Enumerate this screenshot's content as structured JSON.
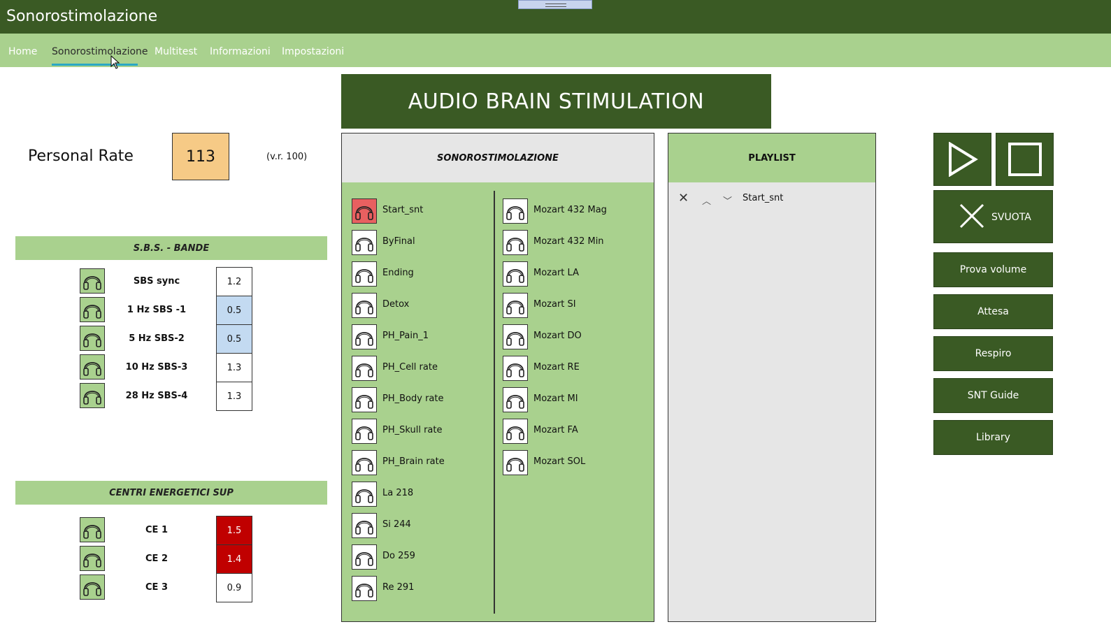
{
  "app": {
    "title": "Sonorostimolazione"
  },
  "nav": {
    "items": [
      {
        "label": "Home"
      },
      {
        "label": "Sonorostimolazione"
      },
      {
        "label": "Multitest"
      },
      {
        "label": "Informazioni"
      },
      {
        "label": "Impostazioni"
      }
    ],
    "active": "Sonorostimolazione"
  },
  "personal_rate": {
    "label": "Personal Rate",
    "value": "113",
    "reference": "(v.r. 100)"
  },
  "sbs": {
    "title": "S.B.S. - BANDE",
    "rows": [
      {
        "label": "SBS sync",
        "value": "1.2",
        "state": "normal"
      },
      {
        "label": "1 Hz SBS -1",
        "value": "0.5",
        "state": "blue"
      },
      {
        "label": "5 Hz SBS-2",
        "value": "0.5",
        "state": "blue"
      },
      {
        "label": "10 Hz SBS-3",
        "value": "1.3",
        "state": "normal"
      },
      {
        "label": "28 Hz SBS-4",
        "value": "1.3",
        "state": "normal"
      }
    ]
  },
  "ce": {
    "title": "CENTRI ENERGETICI SUP",
    "rows": [
      {
        "label": "CE 1",
        "value": "1.5",
        "state": "red"
      },
      {
        "label": "CE 2",
        "value": "1.4",
        "state": "red"
      },
      {
        "label": "CE 3",
        "value": "0.9",
        "state": "normal"
      }
    ]
  },
  "banner": {
    "title": "AUDIO BRAIN STIMULATION"
  },
  "sonorostimolazione": {
    "title": "SONOROSTIMOLAZIONE",
    "left_tracks": [
      "Start_snt",
      "ByFinal",
      "Ending",
      "Detox",
      "PH_Pain_1",
      "PH_Cell rate",
      "PH_Body rate",
      "PH_Skull rate",
      "PH_Brain rate",
      "La 218",
      "Si 244",
      "Do 259",
      "Re 291"
    ],
    "right_tracks": [
      "Mozart 432 Mag",
      "Mozart 432 Min",
      "Mozart  LA",
      "Mozart  SI",
      "Mozart  DO",
      "Mozart  RE",
      "Mozart  MI",
      "Mozart  FA",
      "Mozart  SOL"
    ],
    "highlighted": "Start_snt"
  },
  "playlist": {
    "title": "PLAYLIST",
    "items": [
      {
        "name": "Start_snt"
      }
    ]
  },
  "controls": {
    "svuota_label": "SVUOTA",
    "buttons": [
      {
        "label": "Prova volume"
      },
      {
        "label": "Attesa"
      },
      {
        "label": "Respiro"
      },
      {
        "label": "SNT Guide"
      },
      {
        "label": "Library"
      }
    ]
  },
  "colors": {
    "dark_green": "#3a5a24",
    "light_green": "#a9d18e",
    "rate_orange": "#f6ca86",
    "alert_red": "#c00000",
    "low_blue": "#c3daf1"
  }
}
